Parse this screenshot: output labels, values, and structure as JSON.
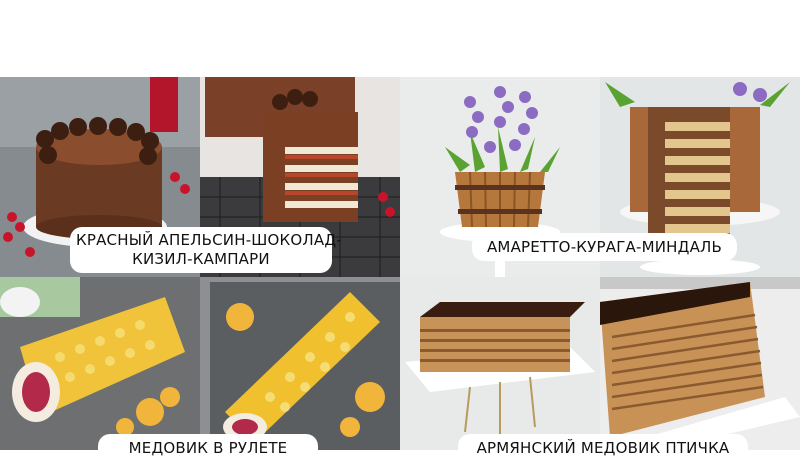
{
  "captions": {
    "q1_line1": "КРАСНЫЙ АПЕЛЬСИН-ШОКОЛАД-",
    "q1_line2": "КИЗИЛ-КАМПАРИ",
    "q2": "АМАРЕТТО-КУРАГА-МИНДАЛЬ",
    "q3": "МЕДОВИК В РУЛЕТЕ",
    "q4": "АРМЯНСКИЙ МЕДОВИК ПТИЧКА"
  },
  "colors": {
    "chocolate": "#5a3320",
    "honey_yellow": "#f1c33a",
    "gray_background": "#6e6e6e",
    "pale_background": "#e9ebea"
  }
}
